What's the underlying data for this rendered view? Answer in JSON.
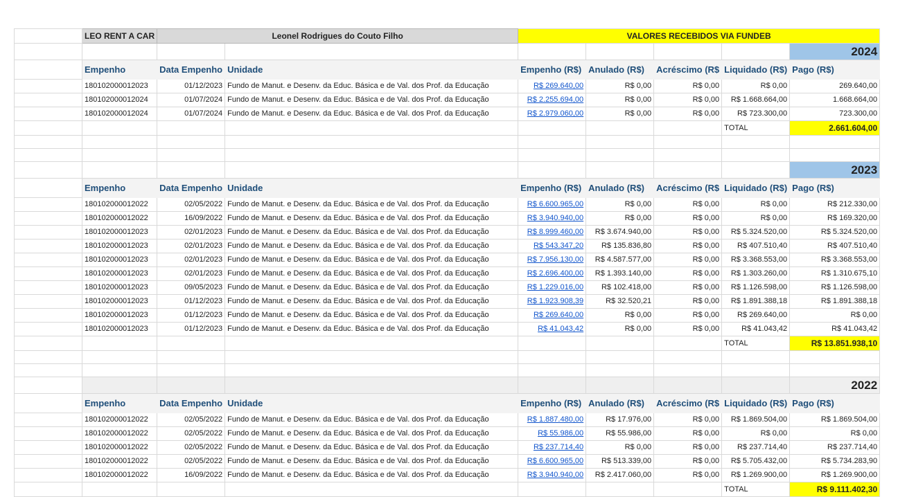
{
  "header": {
    "company": "LEO RENT A CAR",
    "owner": "Leonel Rodrigues do Couto Filho",
    "title": "VALORES RECEBIDOS VIA FUNDEB"
  },
  "columns": [
    "Empenho",
    "Data Empenho",
    "Unidade",
    "Empenho (R$)",
    "Anulado (R$)",
    "Acréscimo (R$",
    "Liquidado (R$)",
    "Pago (R$)"
  ],
  "total_label": "TOTAL",
  "sections": [
    {
      "year": "2024",
      "rows": [
        [
          "180102000012023",
          "01/12/2023",
          "Fundo de Manut. e Desenv. da Educ. Básica e de Val. dos Prof. da Educação",
          "R$ 269.640,00",
          "R$ 0,00",
          "R$ 0,00",
          "R$ 0,00",
          "269.640,00"
        ],
        [
          "180102000012024",
          "01/07/2024",
          "Fundo de Manut. e Desenv. da Educ. Básica e de Val. dos Prof. da Educação",
          "R$ 2.255.694,00",
          "R$ 0,00",
          "R$ 0,00",
          "R$ 1.668.664,00",
          "1.668.664,00"
        ],
        [
          "180102000012024",
          "01/07/2024",
          "Fundo de Manut. e Desenv. da Educ. Básica e de Val. dos Prof. da Educação",
          "R$ 2.979.060,00",
          "R$ 0,00",
          "R$ 0,00",
          "R$ 723.300,00",
          "723.300,00"
        ]
      ],
      "total": "2.661.604,00"
    },
    {
      "year": "2023",
      "rows": [
        [
          "180102000012022",
          "02/05/2022",
          "Fundo de Manut. e Desenv. da Educ. Básica e de Val. dos Prof. da Educação",
          "R$ 6.600.965,00",
          "R$ 0,00",
          "R$ 0,00",
          "R$ 0,00",
          "R$ 212.330,00"
        ],
        [
          "180102000012022",
          "16/09/2022",
          "Fundo de Manut. e Desenv. da Educ. Básica e de Val. dos Prof. da Educação",
          "R$ 3.940.940,00",
          "R$ 0,00",
          "R$ 0,00",
          "R$ 0,00",
          "R$ 169.320,00"
        ],
        [
          "180102000012023",
          "02/01/2023",
          "Fundo de Manut. e Desenv. da Educ. Básica e de Val. dos Prof. da Educação",
          "R$ 8.999.460,00",
          "R$ 3.674.940,00",
          "R$ 0,00",
          "R$ 5.324.520,00",
          "R$ 5.324.520,00"
        ],
        [
          "180102000012023",
          "02/01/2023",
          "Fundo de Manut. e Desenv. da Educ. Básica e de Val. dos Prof. da Educação",
          "R$ 543.347,20",
          "R$ 135.836,80",
          "R$ 0,00",
          "R$ 407.510,40",
          "R$ 407.510,40"
        ],
        [
          "180102000012023",
          "02/01/2023",
          "Fundo de Manut. e Desenv. da Educ. Básica e de Val. dos Prof. da Educação",
          "R$ 7.956.130,00",
          "R$ 4.587.577,00",
          "R$ 0,00",
          "R$ 3.368.553,00",
          "R$ 3.368.553,00"
        ],
        [
          "180102000012023",
          "02/01/2023",
          "Fundo de Manut. e Desenv. da Educ. Básica e de Val. dos Prof. da Educação",
          "R$ 2.696.400,00",
          "R$ 1.393.140,00",
          "R$ 0,00",
          "R$ 1.303.260,00",
          "R$ 1.310.675,10"
        ],
        [
          "180102000012023",
          "09/05/2023",
          "Fundo de Manut. e Desenv. da Educ. Básica e de Val. dos Prof. da Educação",
          "R$ 1.229.016,00",
          "R$ 102.418,00",
          "R$ 0,00",
          "R$ 1.126.598,00",
          "R$ 1.126.598,00"
        ],
        [
          "180102000012023",
          "01/12/2023",
          "Fundo de Manut. e Desenv. da Educ. Básica e de Val. dos Prof. da Educação",
          "R$ 1.923.908,39",
          "R$ 32.520,21",
          "R$ 0,00",
          "R$ 1.891.388,18",
          "R$ 1.891.388,18"
        ],
        [
          "180102000012023",
          "01/12/2023",
          "Fundo de Manut. e Desenv. da Educ. Básica e de Val. dos Prof. da Educação",
          "R$ 269.640,00",
          "R$ 0,00",
          "R$ 0,00",
          "R$ 269.640,00",
          "R$ 0,00"
        ],
        [
          "180102000012023",
          "01/12/2023",
          "Fundo de Manut. e Desenv. da Educ. Básica e de Val. dos Prof. da Educação",
          "R$ 41.043,42",
          "R$ 0,00",
          "R$ 0,00",
          "R$ 41.043,42",
          "R$ 41.043,42"
        ]
      ],
      "total": "R$ 13.851.938,10"
    },
    {
      "year": "2022",
      "rows": [
        [
          "180102000012022",
          "02/05/2022",
          "Fundo de Manut. e Desenv. da Educ. Básica e de Val. dos Prof. da Educação",
          "R$ 1.887.480,00",
          "R$ 17.976,00",
          "R$ 0,00",
          "R$ 1.869.504,00",
          "R$ 1.869.504,00"
        ],
        [
          "180102000012022",
          "02/05/2022",
          "Fundo de Manut. e Desenv. da Educ. Básica e de Val. dos Prof. da Educação",
          "R$ 55.986,00",
          "R$ 55.986,00",
          "R$ 0,00",
          "R$ 0,00",
          "R$ 0,00"
        ],
        [
          "180102000012022",
          "02/05/2022",
          "Fundo de Manut. e Desenv. da Educ. Básica e de Val. dos Prof. da Educação",
          "R$ 237.714,40",
          "R$ 0,00",
          "R$ 0,00",
          "R$ 237.714,40",
          "R$ 237.714,40"
        ],
        [
          "180102000012022",
          "02/05/2022",
          "Fundo de Manut. e Desenv. da Educ. Básica e de Val. dos Prof. da Educação",
          "R$ 6.600.965,00",
          "R$ 513.339,00",
          "R$ 0,00",
          "R$ 5.705.432,00",
          "R$ 5.734.283,90"
        ],
        [
          "180102000012022",
          "16/09/2022",
          "Fundo de Manut. e Desenv. da Educ. Básica e de Val. dos Prof. da Educação",
          "R$ 3.940.940,00",
          "R$ 2.417.060,00",
          "R$ 0,00",
          "R$ 1.269.900,00",
          "R$ 1.269.900,00"
        ]
      ],
      "total": "R$ 9.111.402,30"
    }
  ]
}
